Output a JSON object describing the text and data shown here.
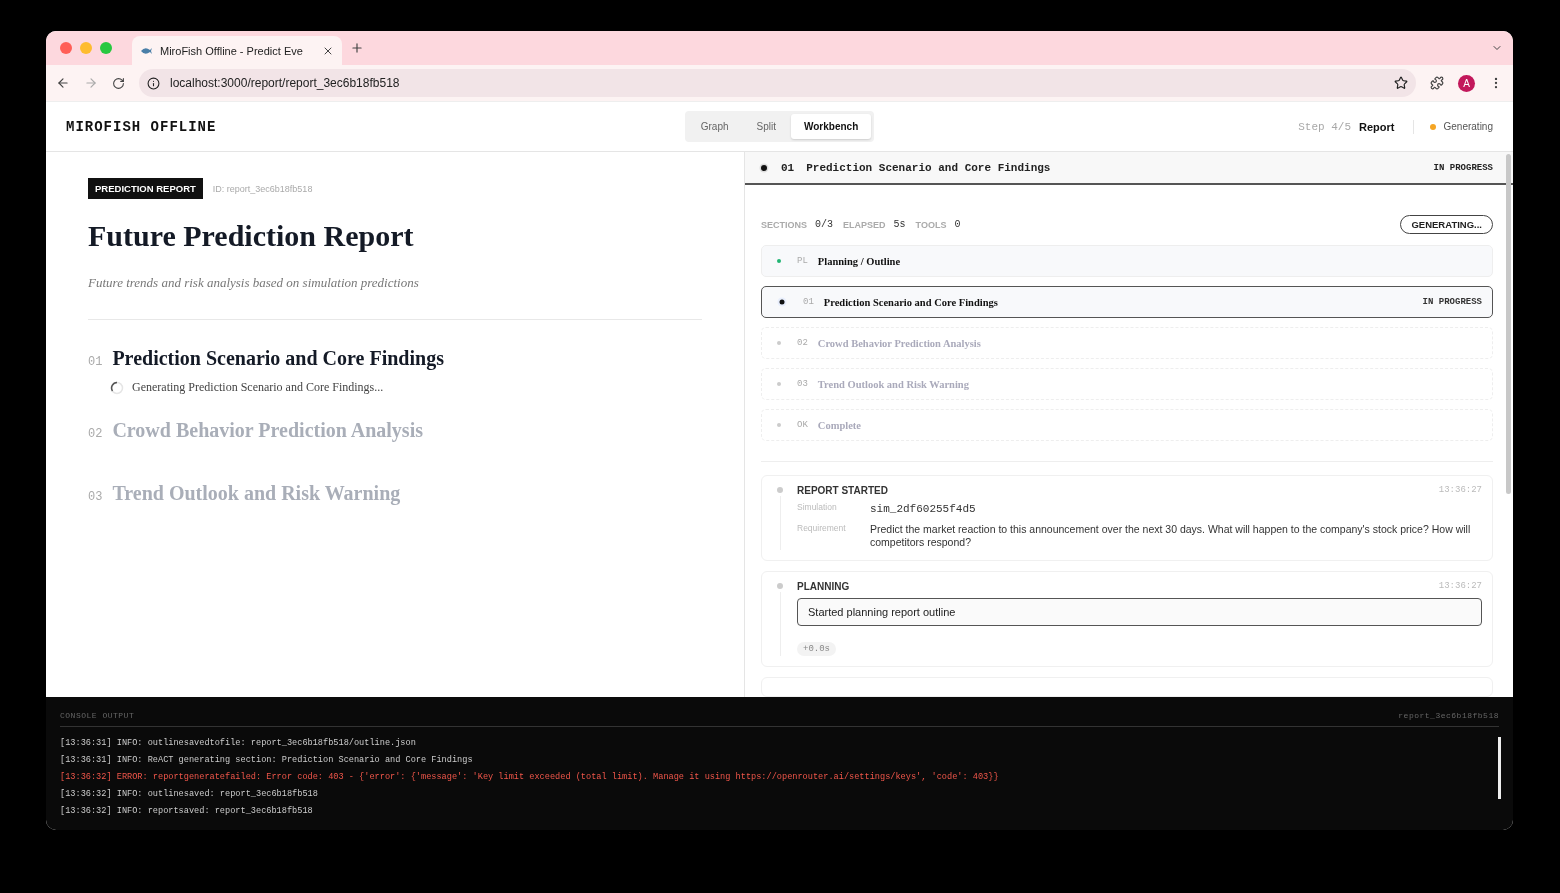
{
  "browser": {
    "tab_title": "MiroFish Offline - Predict Eve",
    "url": "localhost:3000/report/report_3ec6b18fb518",
    "avatar": "A"
  },
  "header": {
    "logo": "MIROFISH OFFLINE",
    "view_tabs": [
      {
        "label": "Graph",
        "selected": false
      },
      {
        "label": "Split",
        "selected": false
      },
      {
        "label": "Workbench",
        "selected": true
      }
    ],
    "step": "Step 4/5",
    "step_name": "Report",
    "status": "Generating",
    "color": "#f5a524"
  },
  "report": {
    "badge": "PREDICTION REPORT",
    "id": "ID: report_3ec6b18fb518",
    "title": "Future Prediction Report",
    "subtitle": "Future trends and risk analysis based on simulation predictions",
    "sections": [
      {
        "number": "01",
        "title": "Prediction Scenario and Core Findings",
        "kind": "active",
        "progress": "Generating Prediction Scenario and Core Findings..."
      },
      {
        "number": "02",
        "title": "Crowd Behavior Prediction Analysis",
        "kind": "pending"
      },
      {
        "number": "03",
        "title": "Trend Outlook and Risk Warning",
        "kind": "pending"
      }
    ]
  },
  "workbench": {
    "current": {
      "number": "01",
      "title": "Prediction Scenario and Core Findings",
      "status": "IN PROGRESS"
    },
    "stats": [
      {
        "label": "SECTIONS",
        "value": "0/3"
      },
      {
        "label": "ELAPSED",
        "value": "5s"
      },
      {
        "label": "TOOLS",
        "value": "0"
      }
    ],
    "button": "GENERATING...",
    "steps": [
      {
        "code": "PL",
        "title": "Planning / Outline",
        "kind": "done"
      },
      {
        "code": "01",
        "title": "Prediction Scenario and Core Findings",
        "kind": "active",
        "status": "IN PROGRESS"
      },
      {
        "code": "02",
        "title": "Crowd Behavior Prediction Analysis",
        "kind": "pending"
      },
      {
        "code": "03",
        "title": "Trend Outlook and Risk Warning",
        "kind": "pending"
      },
      {
        "code": "OK",
        "title": "Complete",
        "kind": "pending"
      }
    ],
    "events": [
      {
        "kind": "fields",
        "title": "REPORT STARTED",
        "time": "13:36:27",
        "fields": [
          {
            "label": "Simulation",
            "value": "sim_2df60255f4d5",
            "mono": true
          },
          {
            "label": "Requirement",
            "value": "Predict the market reaction to this announcement over the next 30 days. What will happen to the company's stock price? How will competitors respond?",
            "mono": false
          }
        ]
      },
      {
        "kind": "message",
        "title": "PLANNING",
        "time": "13:36:27",
        "message": "Started planning report outline",
        "duration": "+0.0s"
      }
    ]
  },
  "console": {
    "title": "CONSOLE OUTPUT",
    "id": "report_3ec6b18fb518",
    "lines": [
      {
        "kind": "info",
        "text": "[13:36:31] INFO: outlinesavedtofile: report_3ec6b18fb518/outline.json"
      },
      {
        "kind": "info",
        "text": "[13:36:31] INFO: ReACT generating section: Prediction Scenario and Core Findings"
      },
      {
        "kind": "error",
        "text": "[13:36:32] ERROR: reportgeneratefailed: Error code: 403 - {'error': {'message': 'Key limit exceeded (total limit). Manage it using https://openrouter.ai/settings/keys', 'code': 403}}"
      },
      {
        "kind": "info",
        "text": "[13:36:32] INFO: outlinesaved: report_3ec6b18fb518"
      },
      {
        "kind": "info",
        "text": "[13:36:32] INFO: reportsaved: report_3ec6b18fb518"
      }
    ]
  }
}
